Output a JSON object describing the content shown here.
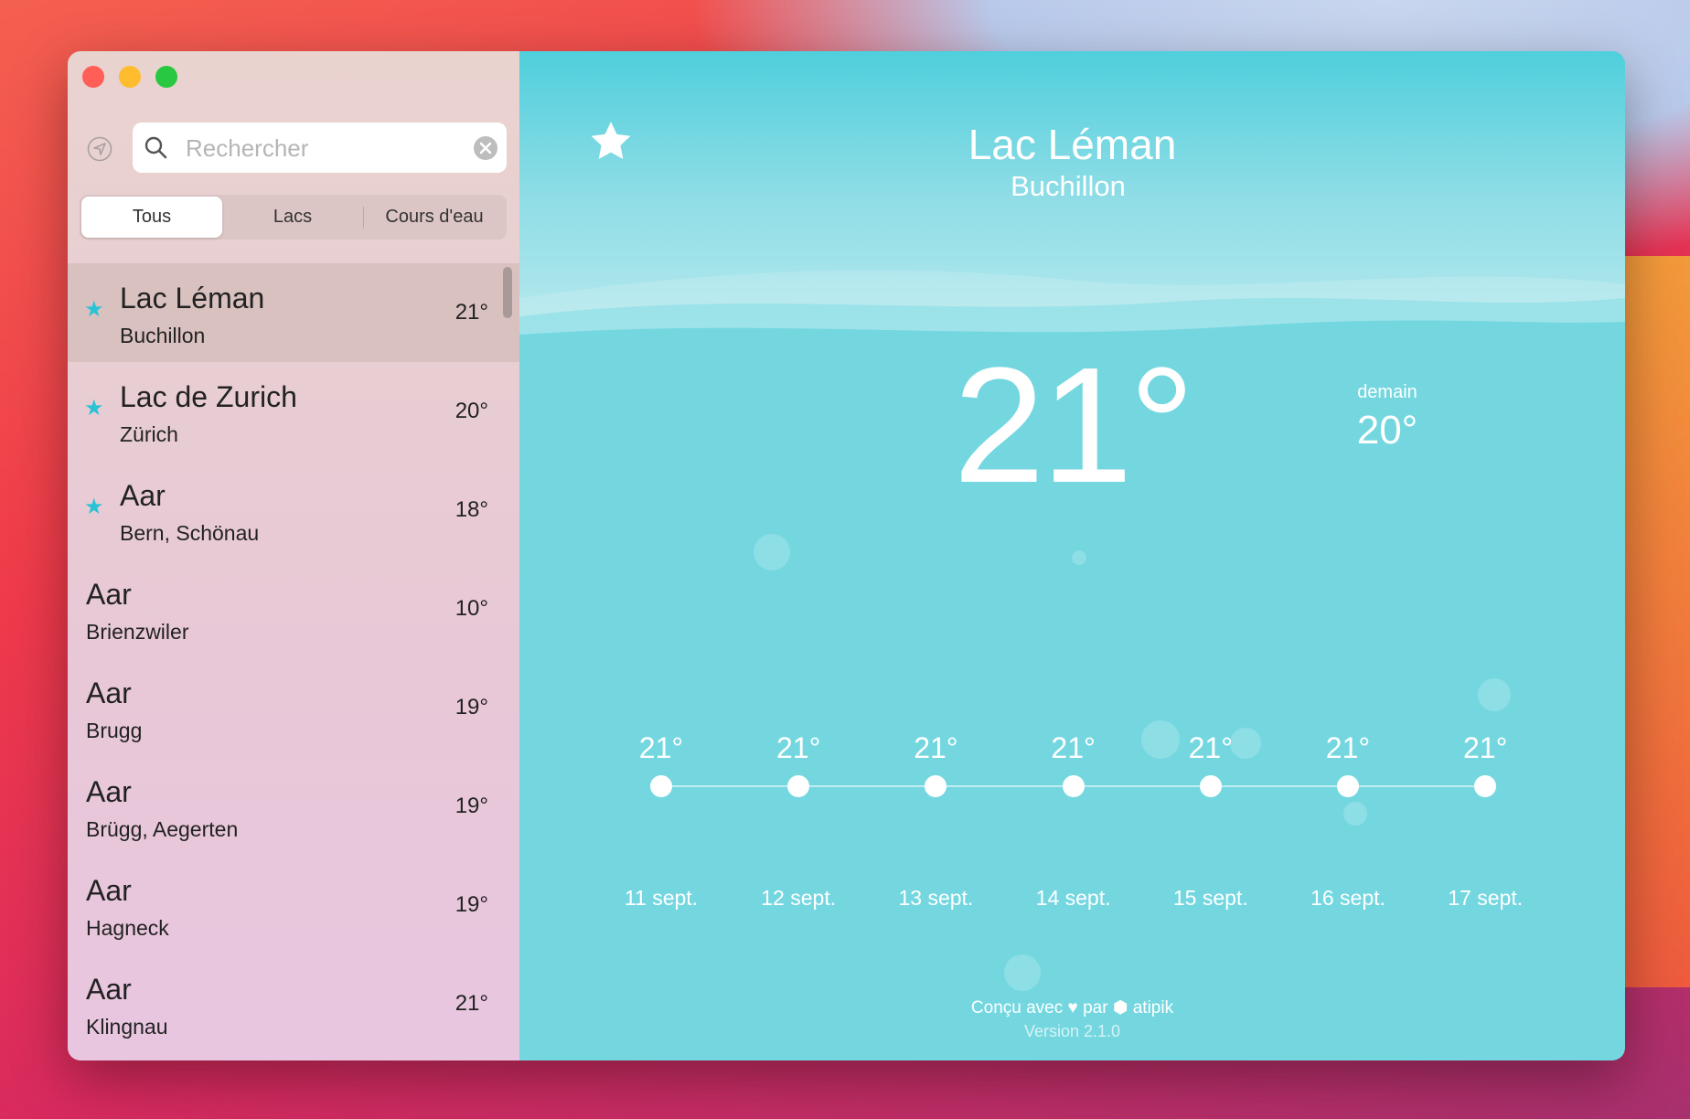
{
  "sidebar": {
    "search_placeholder": "Rechercher",
    "segments": [
      "Tous",
      "Lacs",
      "Cours d'eau"
    ],
    "selected_segment": "Tous",
    "items": [
      {
        "title": "Lac Léman",
        "subtitle": "Buchillon",
        "temp": "21°",
        "favorite": true,
        "selected": true
      },
      {
        "title": "Lac de Zurich",
        "subtitle": "Zürich",
        "temp": "20°",
        "favorite": true
      },
      {
        "title": "Aar",
        "subtitle": "Bern, Schönau",
        "temp": "18°",
        "favorite": true
      },
      {
        "title": "Aar",
        "subtitle": "Brienzwiler",
        "temp": "10°",
        "favorite": false
      },
      {
        "title": "Aar",
        "subtitle": "Brugg",
        "temp": "19°",
        "favorite": false
      },
      {
        "title": "Aar",
        "subtitle": "Brügg, Aegerten",
        "temp": "19°",
        "favorite": false
      },
      {
        "title": "Aar",
        "subtitle": "Hagneck",
        "temp": "19°",
        "favorite": false
      },
      {
        "title": "Aar",
        "subtitle": "Klingnau",
        "temp": "21°",
        "favorite": false
      }
    ]
  },
  "detail": {
    "title": "Lac Léman",
    "subtitle": "Buchillon",
    "temp": "21°",
    "tomorrow_label": "demain",
    "tomorrow_temp": "20°",
    "forecast": [
      {
        "temp": "21°",
        "date": "11 sept."
      },
      {
        "temp": "21°",
        "date": "12 sept."
      },
      {
        "temp": "21°",
        "date": "13 sept."
      },
      {
        "temp": "21°",
        "date": "14 sept."
      },
      {
        "temp": "21°",
        "date": "15 sept."
      },
      {
        "temp": "21°",
        "date": "16 sept."
      },
      {
        "temp": "21°",
        "date": "17 sept."
      }
    ],
    "footer": {
      "made_with": "Conçu avec",
      "by": "par",
      "brand": "atipik",
      "version": "Version 2.1.0"
    }
  },
  "colors": {
    "accent": "#29c3d5",
    "water": "#74d7e0",
    "close": "#ff5f57",
    "minimize": "#febc2e",
    "zoom": "#28c840"
  }
}
